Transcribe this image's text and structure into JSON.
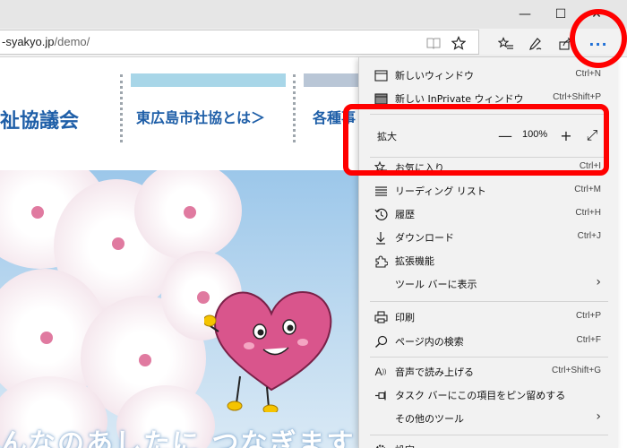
{
  "window": {
    "minimize_glyph": "—",
    "maximize_glyph": "☐",
    "close_glyph": "✕"
  },
  "address_bar": {
    "domain_text": "-syakyo.jp",
    "path_text": "/demo/"
  },
  "toolbar_icons": [
    "reading-view-icon",
    "favorite-star-icon",
    "favorites-hub-icon",
    "web-note-icon",
    "share-icon",
    "more-icon"
  ],
  "page": {
    "site_title": "祉協議会",
    "nav_item_1": "東広島市社協とは＞",
    "nav_item_2": "各種事",
    "hero_text": "んなのあしたに つなぎます"
  },
  "menu": {
    "new_window": {
      "label": "新しいウィンドウ",
      "shortcut": "Ctrl+N"
    },
    "new_inprivate": {
      "label": "新しい InPrivate ウィンドウ",
      "shortcut": "Ctrl+Shift+P"
    },
    "zoom": {
      "label": "拡大",
      "minus": "—",
      "value": "100%",
      "plus": "+",
      "fullscreen": "⤢"
    },
    "items_a": [
      {
        "label": "お気に入り",
        "shortcut": "Ctrl+I",
        "icon": "star-list-icon"
      },
      {
        "label": "リーディング リスト",
        "shortcut": "Ctrl+M",
        "icon": "reading-list-icon"
      },
      {
        "label": "履歴",
        "shortcut": "Ctrl+H",
        "icon": "history-icon"
      },
      {
        "label": "ダウンロード",
        "shortcut": "Ctrl+J",
        "icon": "download-icon"
      },
      {
        "label": "拡張機能",
        "shortcut": "",
        "icon": "extensions-icon"
      },
      {
        "label": "ツール バーに表示",
        "shortcut": "",
        "icon": "",
        "submenu": true
      }
    ],
    "items_b": [
      {
        "label": "印刷",
        "shortcut": "Ctrl+P",
        "icon": "print-icon"
      },
      {
        "label": "ページ内の検索",
        "shortcut": "Ctrl+F",
        "icon": "find-icon"
      }
    ],
    "items_c": [
      {
        "label": "音声で読み上げる",
        "shortcut": "Ctrl+Shift+G",
        "icon": "read-aloud-icon"
      },
      {
        "label": "タスク バーにこの項目をピン留めする",
        "shortcut": "",
        "icon": "pin-icon"
      },
      {
        "label": "その他のツール",
        "shortcut": "",
        "icon": "",
        "submenu": true
      }
    ],
    "settings": {
      "label": "設定"
    },
    "submenu_arrow": "›"
  },
  "highlight_color": "#ff0000",
  "accent_color": "#1f6fd6"
}
